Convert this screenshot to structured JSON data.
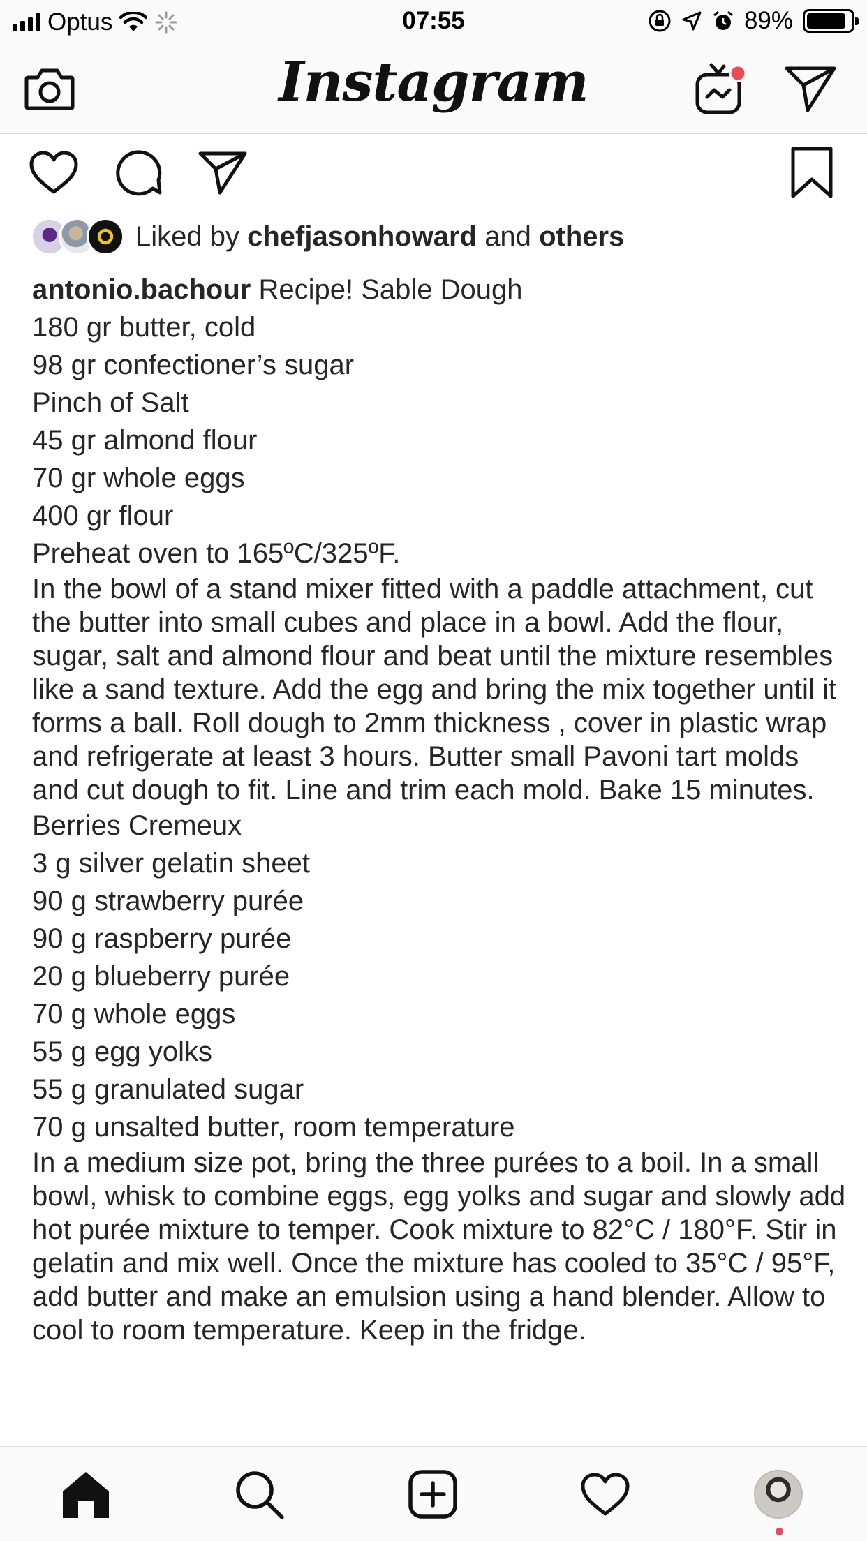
{
  "status_bar": {
    "carrier": "Optus",
    "time": "07:55",
    "battery": "89%",
    "battery_level": 0.89
  },
  "header": {
    "logo_text": "Instagram",
    "camera_icon": "camera-icon",
    "igtv_icon": "igtv-icon",
    "direct_icon": "direct-message-icon"
  },
  "post": {
    "actions": {
      "like_icon": "heart-icon",
      "comment_icon": "comment-icon",
      "share_icon": "share-icon",
      "save_icon": "bookmark-icon"
    },
    "likes": {
      "prefix": "Liked by",
      "user": "chefjasonhoward",
      "joiner": "and",
      "others": "others"
    },
    "caption": {
      "username": "antonio.bachour",
      "lines": [
        "Recipe! Sable Dough",
        "180 gr butter, cold",
        "98 gr confectioner’s sugar",
        "Pinch of Salt",
        "45 gr almond flour",
        "70 gr whole eggs",
        "400 gr flour",
        "Preheat oven to 165ºC/325ºF.",
        "In the bowl of a stand mixer fitted with a paddle attachment, cut the butter into small cubes and place in a bowl. Add the flour, sugar, salt and almond flour and beat until the mixture resembles like a sand texture. Add the egg and bring the mix together until it forms a ball. Roll dough to 2mm thickness , cover in plastic wrap and refrigerate at least 3 hours. Butter small Pavoni tart molds and cut dough to fit. Line and trim each mold. Bake 15 minutes.",
        "Berries Cremeux",
        "3 g silver gelatin sheet",
        "90 g strawberry purée",
        "90 g raspberry purée",
        "20 g blueberry purée",
        "70 g whole eggs",
        "55 g egg yolks",
        "55 g granulated sugar",
        "70 g unsalted butter, room temperature",
        "In a medium size pot, bring the three purées to a boil. In a small bowl, whisk to combine eggs, egg yolks and sugar and slowly add hot purée mixture to temper. Cook mixture to 82°C / 180°F. Stir in gelatin and mix well. Once the mixture has cooled to 35°C / 95°F, add butter and make an emulsion using a hand blender. Allow to cool to room temperature. Keep in the fridge."
      ]
    }
  },
  "tab_bar": {
    "items": [
      "home-icon",
      "search-icon",
      "new-post-icon",
      "activity-icon",
      "profile-avatar"
    ]
  },
  "colors": {
    "text": "#262626",
    "divider": "#dbdbdb",
    "bar_bg": "#fafafa",
    "notification_red": "#ed4956"
  }
}
